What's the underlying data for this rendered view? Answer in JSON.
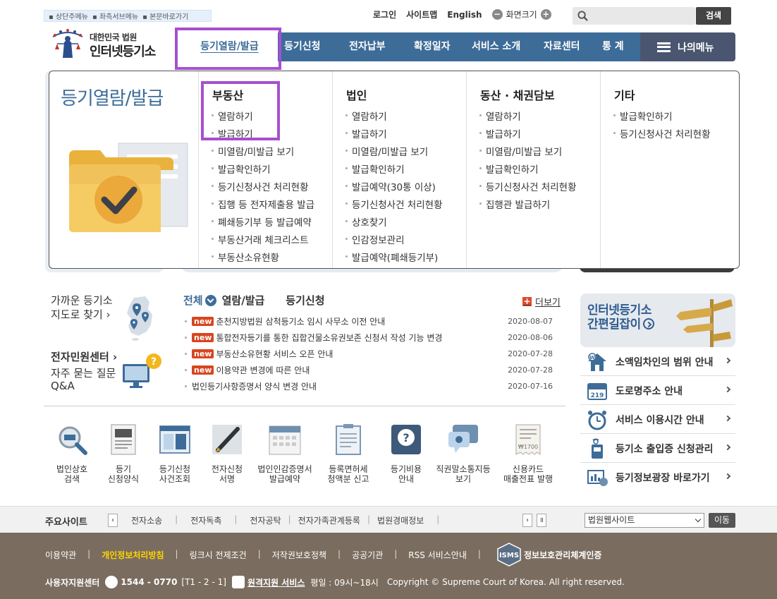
{
  "skip_links": [
    "상단주메뉴",
    "좌측서브메뉴",
    "본문바로가기"
  ],
  "utility": {
    "login": "로그인",
    "sitemap": "사이트맵",
    "english": "English",
    "font_size": "화면크기",
    "minus": "−",
    "plus": "+"
  },
  "search": {
    "placeholder": "",
    "button": "검색"
  },
  "logo": {
    "line1": "대한민국 법원",
    "line2": "인터넷등기소"
  },
  "gnb": {
    "items": [
      "등기열람/발급",
      "등기신청",
      "전자납부",
      "확정일자",
      "서비스 소개",
      "자료센터",
      "통 계"
    ],
    "my_menu": "나의메뉴"
  },
  "mega": {
    "title": "등기열람/발급",
    "columns": [
      {
        "title": "부동산",
        "items": [
          "열람하기",
          "발급하기",
          "미열람/미발급 보기",
          "발급확인하기",
          "등기신청사건 처리현황",
          "집행 등 전자제출용 발급",
          "폐쇄등기부 등 발급예약",
          "부동산거래 체크리스트",
          "부동산소유현황"
        ]
      },
      {
        "title": "법인",
        "items": [
          "열람하기",
          "발급하기",
          "미열람/미발급 보기",
          "발급확인하기",
          "발급예약(30통 이상)",
          "등기신청사건 처리현황",
          "상호찾기",
          "인감정보관리",
          "발급예약(폐쇄등기부)"
        ]
      },
      {
        "title": "동산 · 채권담보",
        "items": [
          "열람하기",
          "발급하기",
          "미열람/미발급 보기",
          "발급확인하기",
          "등기신청사건 처리현황",
          "집행관 발급하기"
        ]
      },
      {
        "title": "기타",
        "items": [
          "발급확인하기",
          "등기신청사건 처리현황"
        ]
      }
    ]
  },
  "quick": {
    "map_line1": "가까운 등기소",
    "map_line2": "지도로 찾기",
    "civil": "전자민원센터",
    "faq_line1": "자주 묻는 질문",
    "faq_line2": "Q&A"
  },
  "news": {
    "tab_all": "전체",
    "tab_view": "열람/발급",
    "tab_apply": "등기신청",
    "more": "더보기",
    "new_label": "new",
    "items": [
      {
        "title": "춘천지방법원 삼척등기소 임시 사무소 이전 안내",
        "date": "2020-08-07",
        "is_new": true
      },
      {
        "title": "통합전자등기를 통한 집합건물소유권보존 신청서 작성 기능 변경",
        "date": "2020-08-06",
        "is_new": true
      },
      {
        "title": "부동산소유현황 서비스 오픈 안내",
        "date": "2020-07-28",
        "is_new": true
      },
      {
        "title": "이용약관 변경에 따른 안내",
        "date": "2020-07-28",
        "is_new": true
      },
      {
        "title": "법인등기사항증명서 양식 변경 안내",
        "date": "2020-07-16",
        "is_new": false
      }
    ]
  },
  "services": [
    {
      "line1": "법인상호",
      "line2": "검색"
    },
    {
      "line1": "등기",
      "line2": "신청양식"
    },
    {
      "line1": "등기신청",
      "line2": "사건조회"
    },
    {
      "line1": "전자신청",
      "line2": "서명"
    },
    {
      "line1": "법인인감증명서",
      "line2": "발급예약"
    },
    {
      "line1": "등록면허세",
      "line2": "청액분 신고"
    },
    {
      "line1": "등기비용",
      "line2": "안내"
    },
    {
      "line1": "직권말소통지등",
      "line2": "보기"
    },
    {
      "line1": "신용카드",
      "line2": "매출전표 발행"
    }
  ],
  "right": {
    "guide_line1": "인터넷등기소",
    "guide_line2": "간편길잡이",
    "links": [
      "소액임차인의 범위 안내",
      "도로명주소 안내",
      "서비스 이용시간 안내",
      "등기소 출입증 신청관리",
      "등기정보광장 바로가기"
    ]
  },
  "sites": {
    "label": "주요사이트",
    "items": [
      "전자소송",
      "전자독촉",
      "전자공탁",
      "전자가족관계등록",
      "법원경매정보"
    ],
    "select": "법원웹사이트",
    "go": "이동"
  },
  "footer": {
    "links": [
      "이용약관",
      "개인정보처리방침",
      "링크시 전제조건",
      "저작권보호정책",
      "공공기관",
      "RSS 서비스안내"
    ],
    "isms": "정보보호관리체계인증",
    "isms_badge": "ISMS",
    "center_label": "사용자지원센터",
    "phone": "1544 - 0770",
    "phone_ext": "[T1 - 2 - 1]",
    "remote": "원격지원 서비스",
    "hours": "평일 : 09시~18시",
    "copyright": "Copyright © Supreme Court of Korea. All right reserved."
  },
  "colors": {
    "primary": "#3d6c98",
    "highlight": "#a64fd1",
    "new_badge": "#d8451f",
    "footer": "#7a6d5f"
  }
}
